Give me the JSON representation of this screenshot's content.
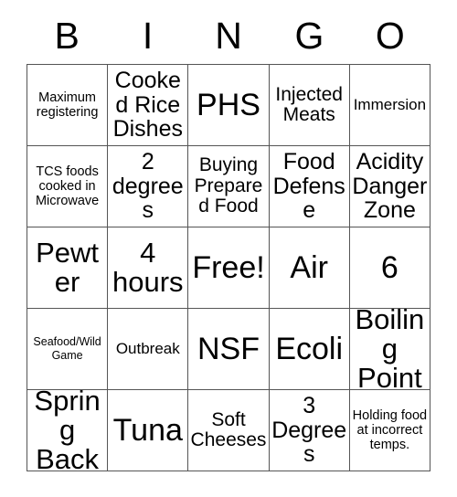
{
  "card": {
    "header_letters": [
      "B",
      "I",
      "N",
      "G",
      "O"
    ],
    "rows": [
      [
        {
          "text": "Maximum registering",
          "size": "s-sm"
        },
        {
          "text": "Cooked Rice Dishes",
          "size": "s-xl"
        },
        {
          "text": "PHS",
          "size": "s-max"
        },
        {
          "text": "Injected Meats",
          "size": "s-lg"
        },
        {
          "text": "Immersion",
          "size": "s-md"
        }
      ],
      [
        {
          "text": "TCS foods cooked in Microwave",
          "size": "s-sm"
        },
        {
          "text": "2 degrees",
          "size": "s-xl"
        },
        {
          "text": "Buying Prepared Food",
          "size": "s-lg"
        },
        {
          "text": "Food Defense",
          "size": "s-xl"
        },
        {
          "text": "Acidity Danger Zone",
          "size": "s-xl"
        }
      ],
      [
        {
          "text": "Pewter",
          "size": "s-xxl"
        },
        {
          "text": "4 hours",
          "size": "s-xxl"
        },
        {
          "text": "Free!",
          "size": "s-max"
        },
        {
          "text": "Air",
          "size": "s-max"
        },
        {
          "text": "6",
          "size": "s-max"
        }
      ],
      [
        {
          "text": "Seafood/Wild Game",
          "size": "s-xs"
        },
        {
          "text": "Outbreak",
          "size": "s-md"
        },
        {
          "text": "NSF",
          "size": "s-max"
        },
        {
          "text": "Ecoli",
          "size": "s-max"
        },
        {
          "text": "Boiling Point",
          "size": "s-xxl"
        }
      ],
      [
        {
          "text": "Spring Back",
          "size": "s-xxl"
        },
        {
          "text": "Tuna",
          "size": "s-max"
        },
        {
          "text": "Soft Cheeses",
          "size": "s-lg"
        },
        {
          "text": "3 Degrees",
          "size": "s-xl"
        },
        {
          "text": "Holding food at incorrect temps.",
          "size": "s-sm"
        }
      ]
    ]
  },
  "style": {
    "background_color": "#ffffff",
    "border_color": "#555555",
    "text_color": "#000000"
  }
}
